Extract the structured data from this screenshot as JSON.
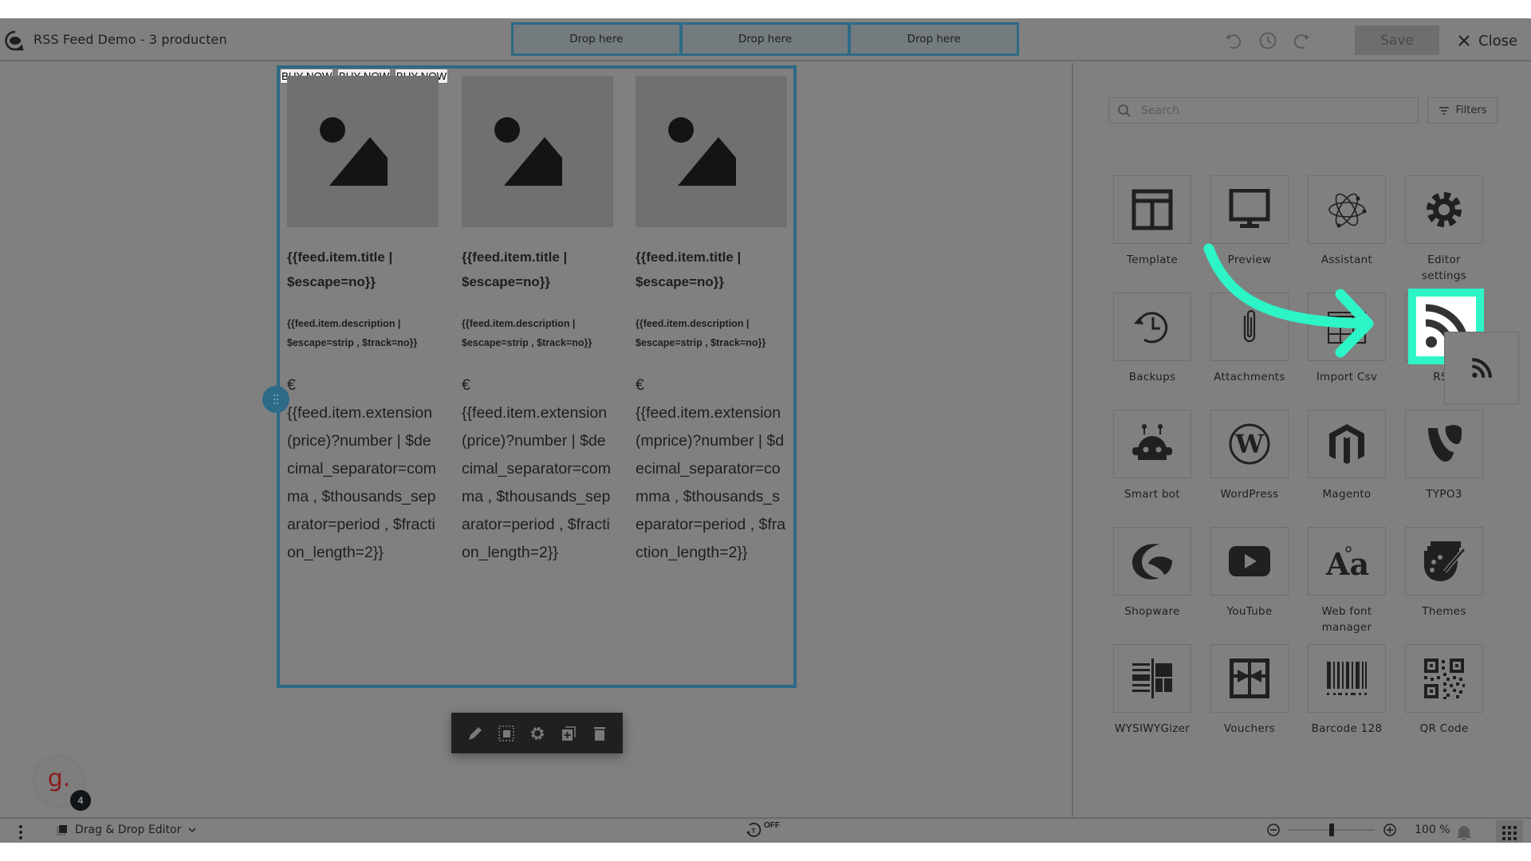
{
  "header": {
    "title": "RSS Feed Demo - 3 producten",
    "drop_zones": [
      "Drop here",
      "Drop here",
      "Drop here"
    ],
    "save_label": "Save",
    "close_label": "Close",
    "icons": [
      "undo-icon",
      "history-icon",
      "redo-icon"
    ]
  },
  "canvas": {
    "products": [
      {
        "title": "{{feed.item.title | $escape=no}}",
        "description": "{{feed.item.description | $escape=strip , $track=no}}",
        "currency": "€",
        "price_expr": "{{feed.item.extension(price)?number | $decimal_separator=comma , $thousands_separator=period , $fraction_length=2}}",
        "button": "BUY NOW"
      },
      {
        "title": "{{feed.item.title | $escape=no}}",
        "description": "{{feed.item.description | $escape=strip , $track=no}}",
        "currency": "€",
        "price_expr": "{{feed.item.extension(price)?number | $decimal_separator=comma , $thousands_separator=period , $fraction_length=2}}",
        "button": "BUY NOW"
      },
      {
        "title": "{{feed.item.title | $escape=no}}",
        "description": "{{feed.item.description | $escape=strip , $track=no}}",
        "currency": "€",
        "price_expr": "{{feed.item.extension(mprice)?number | $decimal_separator=comma , $thousands_separator=period , $fraction_length=2}}",
        "button": "BUY NOW"
      }
    ],
    "block_toolbar": [
      "edit-icon",
      "select-icon",
      "settings-icon",
      "duplicate-icon",
      "delete-icon"
    ]
  },
  "panel": {
    "search_placeholder": "Search",
    "filters_label": "Filters",
    "tools": [
      {
        "label": "Template",
        "icon": "template-icon"
      },
      {
        "label": "Preview",
        "icon": "monitor-icon"
      },
      {
        "label": "Assistant",
        "icon": "atom-icon"
      },
      {
        "label": "Editor settings",
        "icon": "gear-icon"
      },
      {
        "label": "Backups",
        "icon": "history-icon"
      },
      {
        "label": "Attachments",
        "icon": "paperclip-icon"
      },
      {
        "label": "Import Csv",
        "icon": "table-icon"
      },
      {
        "label": "RSS",
        "icon": "rss-icon"
      },
      {
        "label": "Smart bot",
        "icon": "robot-icon"
      },
      {
        "label": "WordPress",
        "icon": "wordpress-icon"
      },
      {
        "label": "Magento",
        "icon": "magento-icon"
      },
      {
        "label": "TYPO3",
        "icon": "typo3-icon"
      },
      {
        "label": "Shopware",
        "icon": "shopware-icon"
      },
      {
        "label": "YouTube",
        "icon": "youtube-icon"
      },
      {
        "label": "Web font manager",
        "icon": "font-icon"
      },
      {
        "label": "Themes",
        "icon": "palette-icon"
      },
      {
        "label": "WYSIWYGizer",
        "icon": "wysiwyg-icon"
      },
      {
        "label": "Vouchers",
        "icon": "gift-icon"
      },
      {
        "label": "Barcode 128",
        "icon": "barcode-icon"
      },
      {
        "label": "QR Code",
        "icon": "qrcode-icon"
      }
    ],
    "highlight_color": "#2df5c6"
  },
  "bottombar": {
    "editor_mode": "Drag & Drop Editor",
    "timer_state": "OFF",
    "zoom_value": "100 %",
    "zoom_fraction": 0.5,
    "notification_count": "4",
    "avatar_letter": "g."
  },
  "colors": {
    "accent_blue": "#2d6a86",
    "highlight": "#2df5c6",
    "overlay_bg": "#808080"
  }
}
